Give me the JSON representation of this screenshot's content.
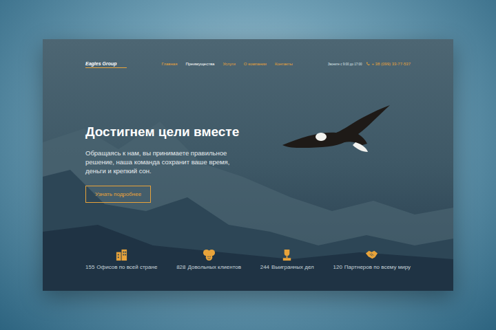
{
  "header": {
    "logo": "Eagles Group",
    "nav": [
      {
        "label": "Главная",
        "selected": false
      },
      {
        "label": "Преимущества",
        "selected": true
      },
      {
        "label": "Услуги",
        "selected": false
      },
      {
        "label": "О компании",
        "selected": false
      },
      {
        "label": "Контакты",
        "selected": false
      }
    ],
    "hours": "Звоните с 9:00 до 17:00",
    "phone": "+ 38 (099) 33-77-537"
  },
  "hero": {
    "title": "Достигнем цели вместе",
    "text": "Обращаясь к нам, вы принимаете правильное решение, наша команда сохранит ваше время, деньги и крепкий сон.",
    "button": "Узнать подробнее"
  },
  "stats": [
    {
      "kind": "offices",
      "number": "155",
      "label": "Офисов по всей стране"
    },
    {
      "kind": "clients",
      "number": "828",
      "label": "Довольных клиентов"
    },
    {
      "kind": "cases",
      "number": "244",
      "label": "Выигранных дел"
    },
    {
      "kind": "partners",
      "number": "120",
      "label": "Партнеров по всему миру"
    }
  ]
}
